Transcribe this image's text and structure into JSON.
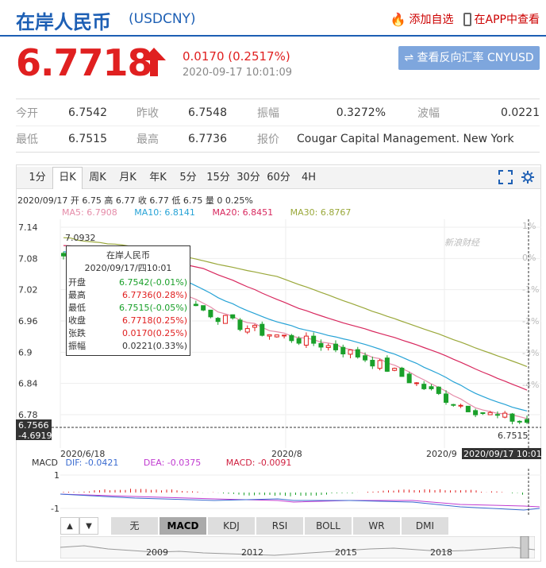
{
  "header": {
    "title": "在岸人民币",
    "code": "(USDCNY)",
    "add_watch": "添加自选",
    "app_view": "在APP中查看"
  },
  "quote": {
    "price": "6.7718",
    "change": "0.0170 (0.2517%)",
    "time": "2020-09-17 10:01:09",
    "reverse_btn": "⇌ 查看反向汇率 CNYUSD"
  },
  "stats": {
    "row1": [
      {
        "label": "今开",
        "value": "6.7542"
      },
      {
        "label": "昨收",
        "value": "6.7548"
      },
      {
        "label": "振幅",
        "value": "0.3272%"
      },
      {
        "label": "波幅",
        "value": "0.0221"
      }
    ],
    "row2": [
      {
        "label": "最低",
        "value": "6.7515"
      },
      {
        "label": "最高",
        "value": "6.7736"
      },
      {
        "label": "报价",
        "value": "Cougar Capital Management. New York"
      }
    ]
  },
  "tabs": [
    "1分",
    "日K",
    "周K",
    "月K",
    "年K",
    "5分",
    "15分",
    "30分",
    "60分",
    "4H"
  ],
  "ohlc_line": "2020/09/17 开 6.75 高 6.77 收 6.77 低 6.75 量 0 0.25%",
  "ma": {
    "ma5": "MA5: 6.7908",
    "ma10": "MA10: 6.8141",
    "ma20": "MA20: 6.8451",
    "ma30": "MA30: 6.8767"
  },
  "colors": {
    "ma5": "#e58ba8",
    "ma10": "#27a3d6",
    "ma20": "#d8285e",
    "ma30": "#9aa83a",
    "up": "#e02020",
    "down": "#1aa02a"
  },
  "tooltip": {
    "name": "在岸人民币",
    "date": "2020/09/17/四10:01",
    "rows": [
      {
        "label": "开盘",
        "value": "6.7542(-0.01%)",
        "color": "#1aa02a"
      },
      {
        "label": "最高",
        "value": "6.7736(0.28%)",
        "color": "#e02020"
      },
      {
        "label": "最低",
        "value": "6.7515(-0.05%)",
        "color": "#1aa02a"
      },
      {
        "label": "收盘",
        "value": "6.7718(0.25%)",
        "color": "#e02020"
      },
      {
        "label": "张跌",
        "value": "0.0170(0.25%)",
        "color": "#e02020"
      },
      {
        "label": "振幅",
        "value": "0.0221(0.33%)",
        "color": "#333333"
      }
    ]
  },
  "chart": {
    "y_ticks": [
      "7.14",
      "7.08",
      "7.02",
      "6.96",
      "6.9",
      "6.84",
      "6.78"
    ],
    "pct_ticks": [
      "1%",
      "0%",
      "-1%",
      "-2%",
      "-3%",
      "-4%"
    ],
    "x_labels": [
      "2020/6/18",
      "2020/8",
      "2020/9"
    ],
    "high_label": "7.0932",
    "low_label": "6.7515",
    "cursor_price": "6.7566",
    "cursor_pct": "-4.6919%",
    "cursor_time": "2020/09/17 10:01",
    "watermark": "新浪财经"
  },
  "macd": {
    "label": "MACD",
    "dif": "DIF: -0.0421",
    "dea": "DEA: -0.0375",
    "macd": "MACD: -0.0091",
    "y_ticks": [
      "1",
      "-1"
    ]
  },
  "indicators": [
    "无",
    "MACD",
    "KDJ",
    "RSI",
    "BOLL",
    "WR",
    "DMI"
  ],
  "indicator_selected": "MACD",
  "scroll": {
    "up": "▲",
    "down": "▼"
  },
  "timeline_years": [
    "2009",
    "2012",
    "2015",
    "2018"
  ]
}
